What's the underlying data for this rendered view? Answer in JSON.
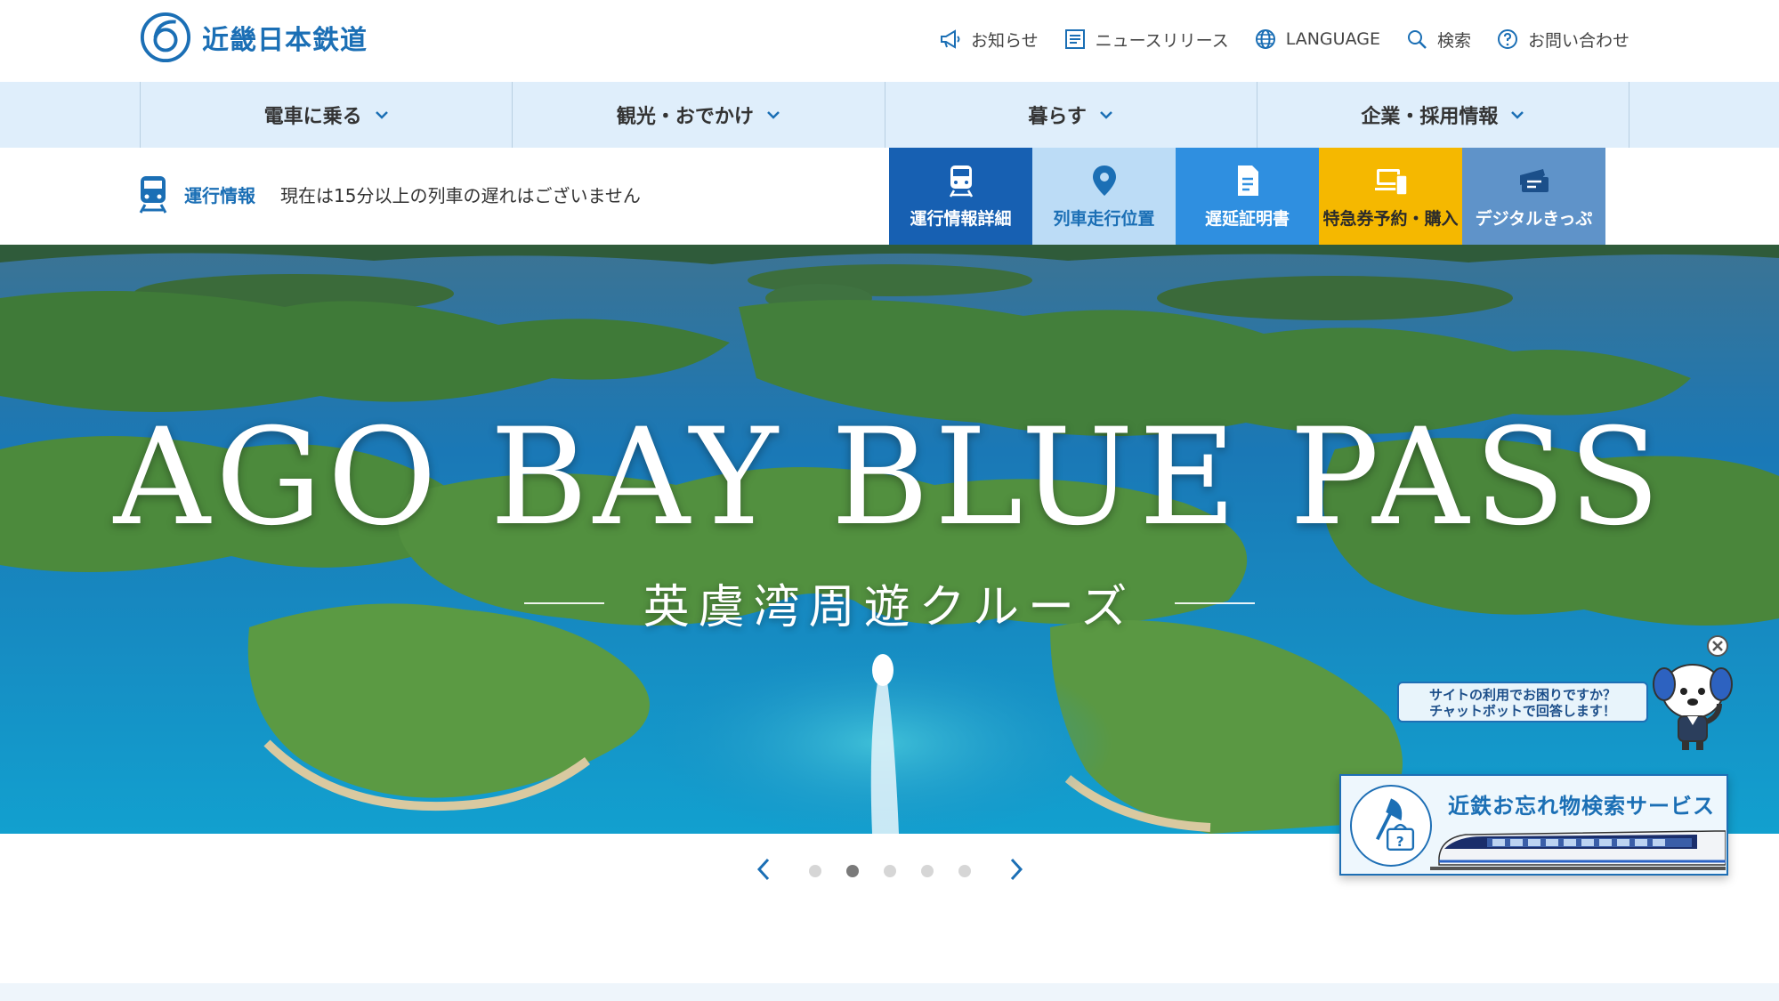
{
  "header": {
    "logo_text": "近畿日本鉄道",
    "utility": [
      {
        "label": "お知らせ",
        "icon": "megaphone-icon"
      },
      {
        "label": "ニュースリリース",
        "icon": "news-icon"
      },
      {
        "label": "LANGUAGE",
        "icon": "globe-icon"
      },
      {
        "label": "検索",
        "icon": "search-icon"
      },
      {
        "label": "お問い合わせ",
        "icon": "question-icon"
      }
    ]
  },
  "gnav": [
    {
      "label": "電車に乗る"
    },
    {
      "label": "観光・おでかけ"
    },
    {
      "label": "暮らす"
    },
    {
      "label": "企業・採用情報"
    }
  ],
  "operation": {
    "label": "運行情報",
    "status": "現在は15分以上の列車の遅れはございません"
  },
  "quick_links": [
    {
      "label": "運行情報詳細",
      "icon": "train-icon"
    },
    {
      "label": "列車走行位置",
      "icon": "location-pin-icon"
    },
    {
      "label": "遅延証明書",
      "icon": "document-icon"
    },
    {
      "label": "特急券予約・購入",
      "icon": "devices-icon"
    },
    {
      "label": "デジタルきっぷ",
      "icon": "ticket-icon"
    }
  ],
  "hero": {
    "title": "AGO BAY BLUE PASS",
    "subtitle": "英虞湾周遊クルーズ"
  },
  "carousel": {
    "slide_count": 5,
    "active_index": 1
  },
  "chatbot": {
    "line1": "サイトの利用でお困りですか？",
    "line2": "チャットボットで回答します！"
  },
  "lost_found": {
    "title": "近鉄お忘れ物検索サービス"
  },
  "colors": {
    "brand_blue": "#1b6fb5",
    "nav_bg": "#dfeefb",
    "q1": "#1760b2",
    "q2": "#bcdcf6",
    "q3": "#2f8fe0",
    "q4": "#f5b800",
    "q5": "#5f93c9"
  }
}
